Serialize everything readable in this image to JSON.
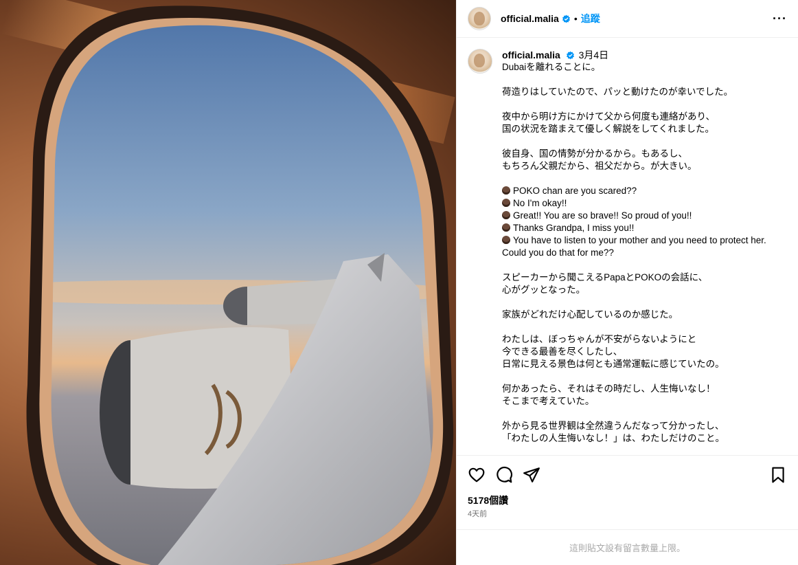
{
  "post": {
    "username": "official.malia",
    "follow_label": "追蹤",
    "separator": "•",
    "more_label": "···",
    "date": "3月4日",
    "caption_title": "Dubaiを離れることに。",
    "paragraphs": [
      [
        "荷造りはしていたので、パッと動けたのが幸いでした。"
      ],
      [
        "夜中から明け方にかけて父から何度も連絡があり、",
        "国の状況を踏まえて優しく解説をしてくれました。"
      ],
      [
        "彼自身、国の情勢が分かるから。もあるし、",
        "もちろん父親だから、祖父だから。が大きい。"
      ]
    ],
    "dialog": [
      "POKO chan are you scared??",
      "No I'm okay!!",
      "Great!! You are so brave!! So proud of you!!",
      "Thanks Grandpa, I miss you!!",
      "You have to listen to your mother and you need to protect her. Could you do that for me??"
    ],
    "paragraphs_after": [
      [
        "スピーカーから聞こえるPapaとPOKOの会話に、",
        "心がグッとなった。"
      ],
      [
        "家族がどれだけ心配しているのか感じた。"
      ],
      [
        "わたしは、ぼっちゃんが不安がらないようにと",
        "今できる最善を尽くしたし、",
        "日常に見える景色は何とも通常運転に感じていたの。"
      ],
      [
        "何かあったら、それはその時だし、人生悔いなし！",
        "そこまで考えていた。"
      ],
      [
        "外から見る世界観は全然違うんだなって分かったし、",
        "「わたしの人生悔いなし！」は、わたしだけのこと。"
      ]
    ],
    "likes": "5178個讚",
    "time_ago": "4天前",
    "comments_disabled": "這則貼文設有留言數量上限。"
  },
  "icons": {
    "like": "heart-icon",
    "comment": "comment-icon",
    "share": "share-icon",
    "save": "bookmark-icon",
    "verified": "verified-badge-icon",
    "emoji": "face-emoji-icon"
  },
  "colors": {
    "link": "#0095f6",
    "verified": "#0095f6",
    "muted": "#737373",
    "footer_text": "#a8a8a8"
  }
}
